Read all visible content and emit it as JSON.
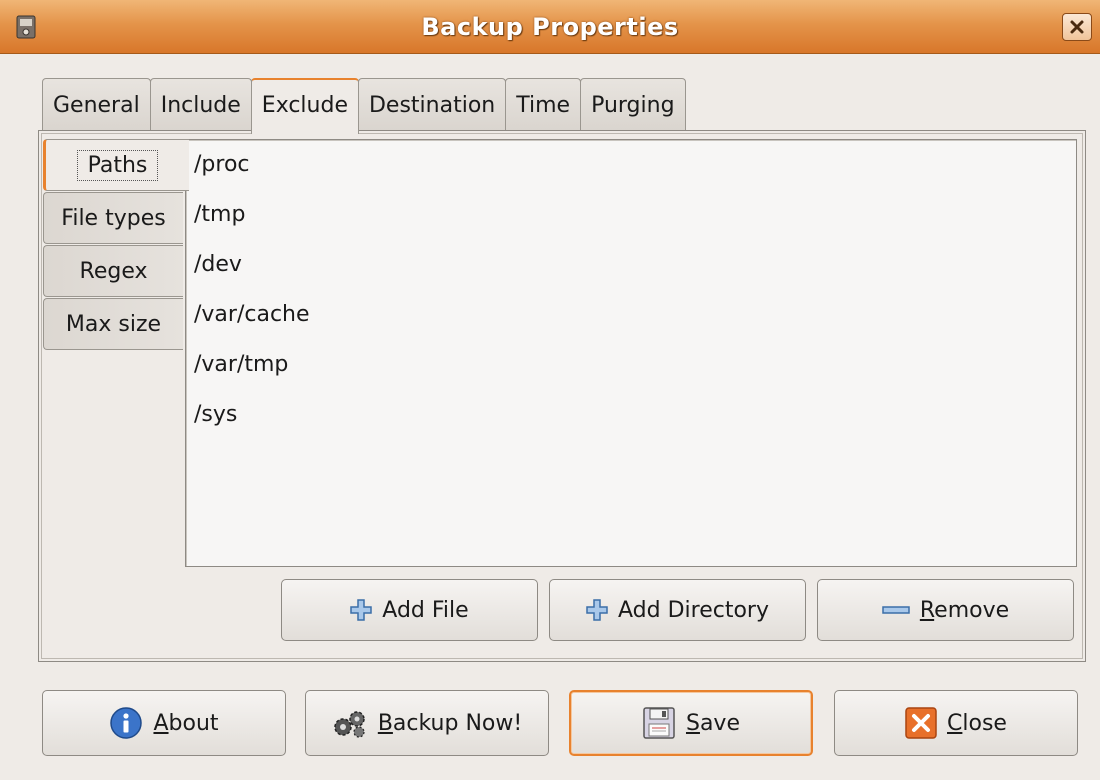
{
  "window": {
    "title": "Backup Properties",
    "app_icon": "backup-app-icon",
    "close_icon": "close-icon",
    "accent_color": "#e8822e"
  },
  "tabs": [
    {
      "label": "General",
      "active": false
    },
    {
      "label": "Include",
      "active": false
    },
    {
      "label": "Exclude",
      "active": true
    },
    {
      "label": "Destination",
      "active": false
    },
    {
      "label": "Time",
      "active": false
    },
    {
      "label": "Purging",
      "active": false
    }
  ],
  "side_tabs": [
    {
      "label": "Paths",
      "active": true
    },
    {
      "label": "File types",
      "active": false
    },
    {
      "label": "Regex",
      "active": false
    },
    {
      "label": "Max size",
      "active": false
    }
  ],
  "excluded_paths": [
    "/proc",
    "/tmp",
    "/dev",
    "/var/cache",
    "/var/tmp",
    "/sys"
  ],
  "list_buttons": {
    "add_file": {
      "label": "Add File",
      "icon": "plus-icon"
    },
    "add_directory": {
      "label": "Add Directory",
      "icon": "plus-icon"
    },
    "remove": {
      "mnemonic": "R",
      "rest": "emove",
      "icon": "minus-icon"
    }
  },
  "dialog_buttons": {
    "about": {
      "mnemonic": "A",
      "rest": "bout",
      "icon": "info-icon"
    },
    "backup_now": {
      "mnemonic": "B",
      "rest": "ackup Now!",
      "icon": "gears-icon"
    },
    "save": {
      "mnemonic": "S",
      "rest": "ave",
      "icon": "floppy-disk-icon"
    },
    "close": {
      "mnemonic": "C",
      "rest": "lose",
      "icon": "close-x-icon"
    }
  }
}
